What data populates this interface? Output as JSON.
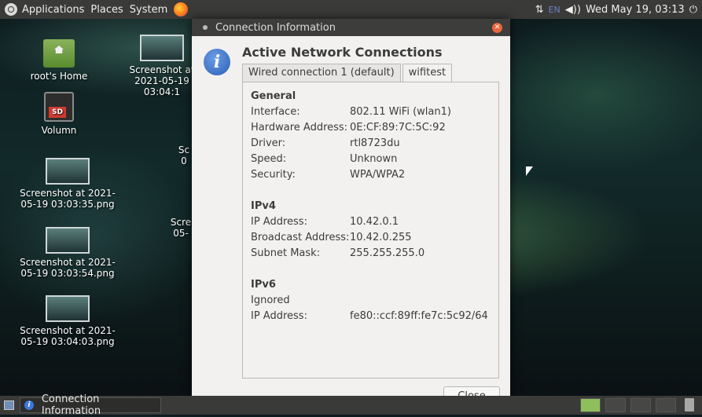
{
  "top_panel": {
    "menus": [
      "Applications",
      "Places",
      "System"
    ],
    "keyboard": "EN",
    "volume": "◀))",
    "datetime": "Wed May 19, 03:13",
    "network": "⇅",
    "power": "⏻"
  },
  "desktop": {
    "icons": [
      {
        "label": "root's Home"
      },
      {
        "label": "Volumn"
      },
      {
        "label": "Screenshot at 2021-05-19 03:03:35.png"
      },
      {
        "label": "Screenshot at 2021-05-19 03:03:54.png"
      },
      {
        "label": "Screenshot at 2021-05-19 03:04:03.png"
      },
      {
        "label": "Screenshot at 2021-05-19 03:04:1"
      },
      {
        "label": "Sc\n0"
      },
      {
        "label": "Scre\n05-"
      }
    ]
  },
  "dialog": {
    "title": "Connection Information",
    "heading": "Active Network Connections",
    "tabs": [
      "Wired connection 1 (default)",
      "wifitest"
    ],
    "general": {
      "title": "General",
      "rows": [
        {
          "label": "Interface:",
          "value": "802.11 WiFi (wlan1)"
        },
        {
          "label": "Hardware Address:",
          "value": "0E:CF:89:7C:5C:92"
        },
        {
          "label": "Driver:",
          "value": "rtl8723du"
        },
        {
          "label": "Speed:",
          "value": "Unknown"
        },
        {
          "label": "Security:",
          "value": "WPA/WPA2"
        }
      ]
    },
    "ipv4": {
      "title": "IPv4",
      "rows": [
        {
          "label": "IP Address:",
          "value": "10.42.0.1"
        },
        {
          "label": "Broadcast Address:",
          "value": "10.42.0.255"
        },
        {
          "label": "Subnet Mask:",
          "value": "255.255.255.0"
        }
      ]
    },
    "ipv6": {
      "title": "IPv6",
      "ignored": "Ignored",
      "rows": [
        {
          "label": "IP Address:",
          "value": "fe80::ccf:89ff:fe7c:5c92/64"
        }
      ]
    },
    "close_label": "Close"
  },
  "bottom_panel": {
    "task_label": "Connection Information"
  }
}
